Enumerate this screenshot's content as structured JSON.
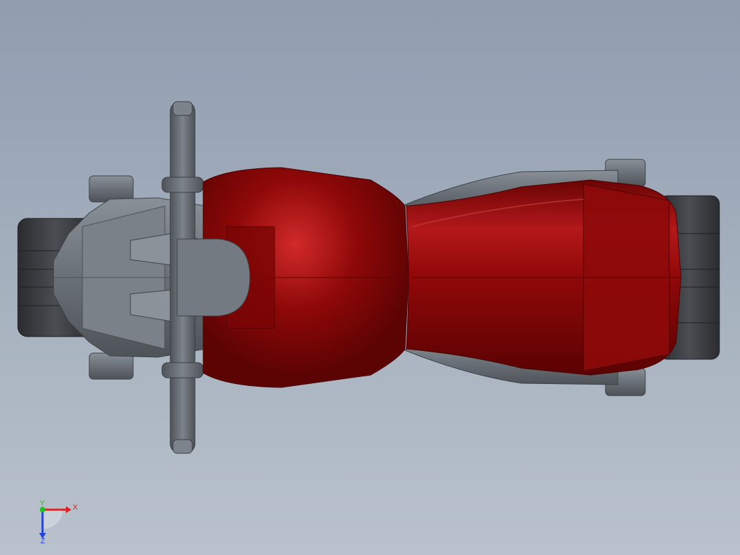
{
  "viewport": {
    "background_top": "#8f9daf",
    "background_bottom": "#b9c2cc"
  },
  "model": {
    "body_color": "#8a0a0a",
    "body_highlight": "#c01a1a",
    "metal_color": "#6e747b",
    "tire_color": "#3a3d41"
  },
  "triad": {
    "x_label": "X",
    "y_label": "Y",
    "z_label": "Z",
    "x_color": "#e02020",
    "y_color": "#20c020",
    "z_color": "#2040e0"
  }
}
